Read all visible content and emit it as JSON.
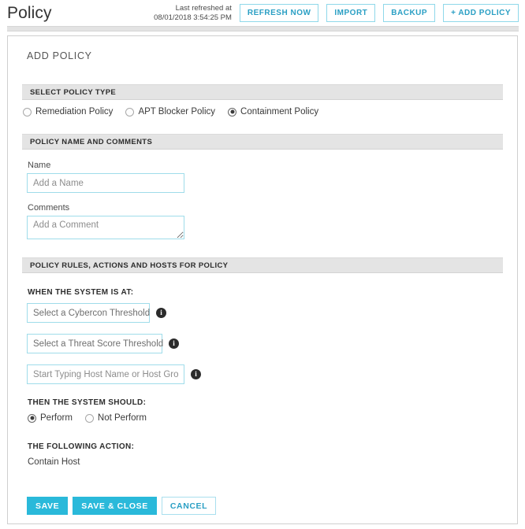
{
  "header": {
    "title": "Policy",
    "refreshed_label": "Last refreshed at",
    "refreshed_time": "08/01/2018 3:54:25 PM",
    "buttons": [
      {
        "label": "REFRESH NOW",
        "name": "refresh-now-button"
      },
      {
        "label": "IMPORT",
        "name": "import-button"
      },
      {
        "label": "BACKUP",
        "name": "backup-button"
      },
      {
        "label": "+ ADD POLICY",
        "name": "add-policy-button"
      }
    ]
  },
  "panel": {
    "heading": "ADD POLICY",
    "sections": {
      "policy_type": {
        "bar_label": "SELECT POLICY TYPE",
        "options": [
          {
            "label": "Remediation Policy",
            "checked": false
          },
          {
            "label": "APT Blocker Policy",
            "checked": false
          },
          {
            "label": "Containment Policy",
            "checked": true
          }
        ]
      },
      "name_comments": {
        "bar_label": "POLICY NAME AND COMMENTS",
        "name_label": "Name",
        "name_placeholder": "Add a Name",
        "name_value": "",
        "comments_label": "Comments",
        "comments_placeholder": "Add a Comment",
        "comments_value": ""
      },
      "rules": {
        "bar_label": "POLICY RULES, ACTIONS AND HOSTS FOR POLICY",
        "when_label": "WHEN THE SYSTEM IS AT:",
        "cybercon_select": "Select a Cybercon Threshold",
        "threat_select": "Select a Threat Score Threshold",
        "host_placeholder": "Start Typing Host Name or Host Group",
        "host_value": "",
        "caret_glyph": "▼",
        "info_glyph": "i",
        "then_label": "THEN THE SYSTEM SHOULD:",
        "perform_options": [
          {
            "label": "Perform",
            "checked": true
          },
          {
            "label": "Not Perform",
            "checked": false
          }
        ],
        "action_label": "THE FOLLOWING ACTION:",
        "action_value": "Contain Host"
      }
    },
    "footer": {
      "save_label": "SAVE",
      "save_close_label": "SAVE & CLOSE",
      "cancel_label": "CANCEL"
    }
  },
  "colors": {
    "accent": "#2ab9da",
    "accent_text": "#2a9fc4",
    "section_bar": "#e4e4e4",
    "input_border": "#9fdcea"
  }
}
